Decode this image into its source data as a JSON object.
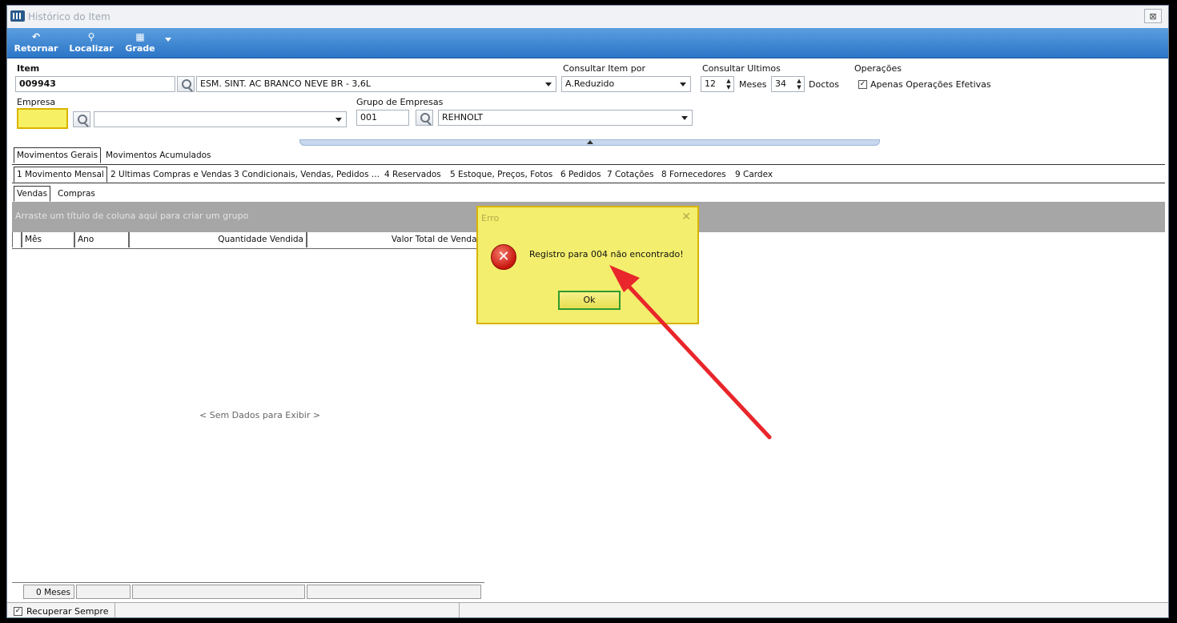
{
  "window": {
    "title": "Histórico do Item",
    "close_label": "⊠"
  },
  "toolbar": {
    "items": [
      {
        "label": "Retornar",
        "icon": "↶"
      },
      {
        "label": "Localizar",
        "icon": "⚲"
      },
      {
        "label": "Grade",
        "icon": "▦"
      }
    ]
  },
  "form": {
    "item_label": "Item",
    "item_code": "009943",
    "item_description": "ESM. SINT. AC BRANCO NEVE BR - 3,6L",
    "consultar_item_por_label": "Consultar Item por",
    "consultar_item_por_value": "A.Reduzido",
    "consultar_ultimos_label": "Consultar Ultimos",
    "meses_value": "12",
    "meses_label": "Meses",
    "doctos_value": "34",
    "doctos_label": "Doctos",
    "operacoes_label": "Operações",
    "apenas_operacoes_label": "Apenas Operações Efetivas",
    "apenas_operacoes_check": "✓",
    "empresa_label": "Empresa",
    "empresa_value": "",
    "empresa_name": "",
    "grupo_label": "Grupo de Empresas",
    "grupo_code": "001",
    "grupo_name": "REHNOLT"
  },
  "tabs_level1": [
    {
      "label": "Movimentos Gerais"
    },
    {
      "label": "Movimentos Acumulados"
    }
  ],
  "tabs_level2": [
    {
      "label": "1 Movimento Mensal"
    },
    {
      "label": "2 Ultimas Compras e Vendas"
    },
    {
      "label": "3 Condicionais, Vendas, Pedidos ..."
    },
    {
      "label": "4 Reservados"
    },
    {
      "label": "5 Estoque, Preços, Fotos"
    },
    {
      "label": "6 Pedidos"
    },
    {
      "label": "7 Cotações"
    },
    {
      "label": "8 Fornecedores"
    },
    {
      "label": "9 Cardex"
    }
  ],
  "tabs_level3": [
    {
      "label": "Vendas"
    },
    {
      "label": "Compras"
    }
  ],
  "grid": {
    "group_hint": "Arraste um título de coluna aqui para criar um grupo",
    "columns": [
      "Mês",
      "Ano",
      "Quantidade Vendida",
      "Valor Total de Vendas"
    ],
    "empty_text": "< Sem Dados para Exibir >",
    "footer_count": "0 Meses"
  },
  "status": {
    "recuperar_label": "Recuperar Sempre",
    "recuperar_check": "✓"
  },
  "dialog": {
    "title": "Erro",
    "close": "✕",
    "icon": "✕",
    "message": "Registro para 004 não encontrado!",
    "ok_label": "Ok"
  },
  "colors": {
    "toolbar": "#3b86d6",
    "dialog_highlight": "#f3ee6d",
    "arrow": "#e8262b"
  }
}
